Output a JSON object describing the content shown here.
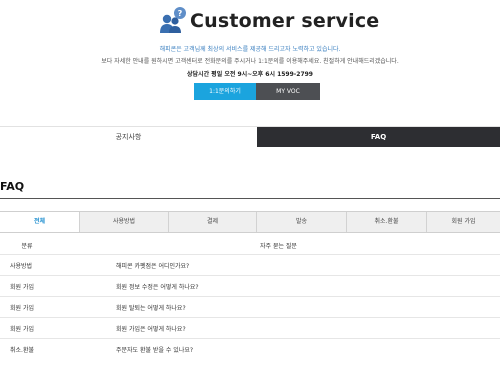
{
  "header": {
    "title": "Customer service",
    "line1": "해피콘은 고객님께 최상의 서비스를 제공해 드리고자 노력하고 있습니다.",
    "line2": "보다 자세한 안내를 원하시면 고객센터로 전화문의를 주시거나 1:1문의를 이용해주세요. 친절하게 안내해드리겠습니다.",
    "hours": "상담시간 평일 오전 9시~오후 6시 1599-2799",
    "ask_button": "1:1문의하기",
    "voc_button": "MY VOC",
    "icon": "customer-support-icon",
    "accent_color": "#1ba4de"
  },
  "top_tabs": [
    {
      "label": "공지사항",
      "active": false
    },
    {
      "label": "FAQ",
      "active": true
    }
  ],
  "faq": {
    "title": "FAQ",
    "categories": [
      "전체",
      "사용방법",
      "결제",
      "발송",
      "취소.환불",
      "회원 가입"
    ],
    "active_category": "전체",
    "columns": {
      "category": "분류",
      "question": "자주 묻는 질문"
    },
    "rows": [
      {
        "category": "사용방법",
        "question": "해피콘 카펫점은 어디인가요?"
      },
      {
        "category": "회원 가입",
        "question": "회원 정보 수정은 어떻게 하나요?"
      },
      {
        "category": "회원 가입",
        "question": "회원 탈퇴는 어떻게 하나요?"
      },
      {
        "category": "회원 가입",
        "question": "회원 가입은 어떻게 하나요?"
      },
      {
        "category": "취소.환불",
        "question": "주문자도 환불 받을 수 있나요?"
      }
    ]
  }
}
